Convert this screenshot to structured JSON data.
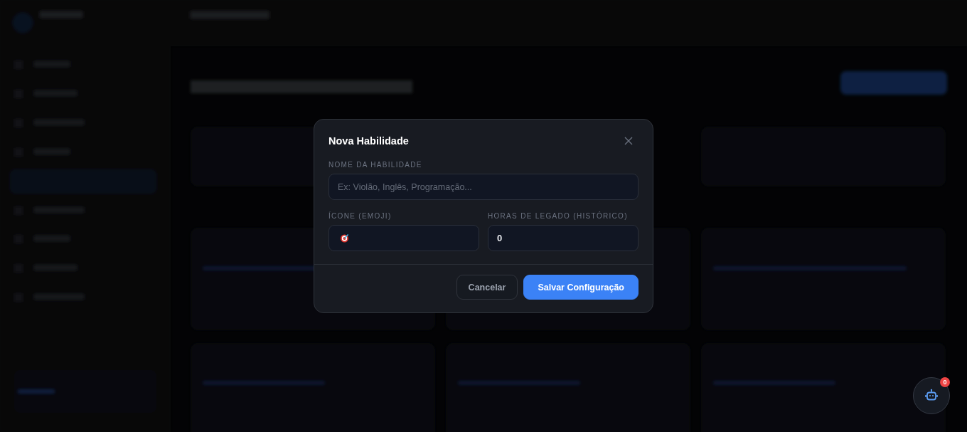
{
  "modal": {
    "title": "Nova Habilidade",
    "fields": [
      {
        "label": "NOME DA HABILIDADE",
        "placeholder": "Ex: Violão, Inglês, Programação...",
        "kind": "text"
      },
      {
        "label": "ÍCONE (EMOJI)",
        "kind": "emoji"
      },
      {
        "label": "HORAS DE LEGADO (HISTÓRICO)",
        "value": "0",
        "kind": "text"
      }
    ],
    "buttons": [
      {
        "label": "Cancelar",
        "kind": "secondary"
      },
      {
        "label": "Salvar Configuração",
        "kind": "primary"
      }
    ]
  },
  "assistant_button": {
    "badge": "0"
  }
}
